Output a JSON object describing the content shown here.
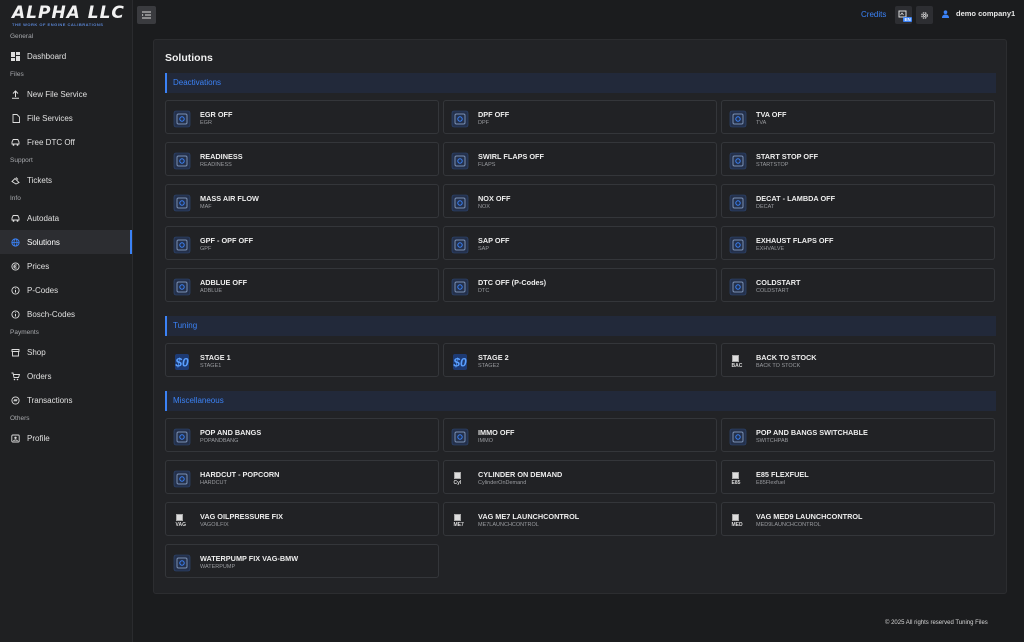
{
  "brand": {
    "name": "ALPHA LLC",
    "tagline": "THE WORK OF ENGINE CALIBRATIONS"
  },
  "sidebar": {
    "sections": [
      {
        "label": "General",
        "items": [
          {
            "label": "Dashboard",
            "icon": "dashboard-icon"
          }
        ]
      },
      {
        "label": "Files",
        "items": [
          {
            "label": "New File Service",
            "icon": "upload-icon"
          },
          {
            "label": "File Services",
            "icon": "file-icon"
          },
          {
            "label": "Free DTC Off",
            "icon": "car-icon"
          }
        ]
      },
      {
        "label": "Support",
        "items": [
          {
            "label": "Tickets",
            "icon": "ticket-icon"
          }
        ]
      },
      {
        "label": "Info",
        "items": [
          {
            "label": "Autodata",
            "icon": "car-icon"
          },
          {
            "label": "Solutions",
            "icon": "globe-icon",
            "active": true
          },
          {
            "label": "Prices",
            "icon": "euro-icon"
          },
          {
            "label": "P-Codes",
            "icon": "info-icon"
          },
          {
            "label": "Bosch-Codes",
            "icon": "info-icon"
          }
        ]
      },
      {
        "label": "Payments",
        "items": [
          {
            "label": "Shop",
            "icon": "shop-icon"
          },
          {
            "label": "Orders",
            "icon": "cart-icon"
          },
          {
            "label": "Transactions",
            "icon": "transactions-icon"
          }
        ]
      },
      {
        "label": "Others",
        "items": [
          {
            "label": "Profile",
            "icon": "profile-icon"
          }
        ]
      }
    ]
  },
  "header": {
    "credits_label": "Credits",
    "lang_badge": "EN",
    "user_name": "demo company1"
  },
  "page": {
    "title": "Solutions"
  },
  "groups": [
    {
      "label": "Deactivations",
      "items": [
        {
          "title": "EGR OFF",
          "sub": "EGR",
          "icon": "egr-icon"
        },
        {
          "title": "DPF OFF",
          "sub": "DPF",
          "icon": "dpf-icon"
        },
        {
          "title": "TVA OFF",
          "sub": "TVA",
          "icon": "tva-icon"
        },
        {
          "title": "READINESS",
          "sub": "READINESS",
          "icon": "readiness-icon"
        },
        {
          "title": "SWIRL FLAPS OFF",
          "sub": "FLAPS",
          "icon": "swirl-flaps-icon"
        },
        {
          "title": "START STOP OFF",
          "sub": "STARTSTOP",
          "icon": "start-stop-icon"
        },
        {
          "title": "MASS AIR FLOW",
          "sub": "MAF",
          "icon": "maf-icon"
        },
        {
          "title": "NOX OFF",
          "sub": "NOX",
          "icon": "nox-icon"
        },
        {
          "title": "DECAT - LAMBDA OFF",
          "sub": "DECAT",
          "icon": "decat-icon"
        },
        {
          "title": "GPF - OPF OFF",
          "sub": "GPF",
          "icon": "gpf-icon"
        },
        {
          "title": "SAP OFF",
          "sub": "SAP",
          "icon": "sap-icon"
        },
        {
          "title": "EXHAUST FLAPS OFF",
          "sub": "EXHVALVE",
          "icon": "exhaust-flaps-icon"
        },
        {
          "title": "ADBLUE OFF",
          "sub": "ADBLUE",
          "icon": "adblue-icon"
        },
        {
          "title": "DTC OFF (P-Codes)",
          "sub": "DTC",
          "icon": "dtc-icon"
        },
        {
          "title": "COLDSTART",
          "sub": "COLDSTART",
          "icon": "coldstart-icon"
        }
      ]
    },
    {
      "label": "Tuning",
      "items": [
        {
          "title": "STAGE 1",
          "sub": "STAGE1",
          "icon": "stage-icon"
        },
        {
          "title": "STAGE 2",
          "sub": "STAGE2",
          "icon": "stage-icon"
        },
        {
          "title": "BACK TO STOCK",
          "sub": "BACK TO STOCK",
          "icon": "broken-image-icon",
          "alt": "BAC"
        }
      ]
    },
    {
      "label": "Miscellaneous",
      "items": [
        {
          "title": "POP AND BANGS",
          "sub": "POPANDBANG",
          "icon": "pop-bang-icon"
        },
        {
          "title": "IMMO OFF",
          "sub": "IMMO",
          "icon": "immo-icon"
        },
        {
          "title": "POP AND BANGS SWITCHABLE",
          "sub": "SWITCHPAB",
          "icon": "pop-bang-icon"
        },
        {
          "title": "HARDCUT - POPCORN",
          "sub": "HARDCUT",
          "icon": "hardcut-icon"
        },
        {
          "title": "CYLINDER ON DEMAND",
          "sub": "CylinderOnDemand",
          "icon": "broken-image-icon",
          "alt": "Cyl"
        },
        {
          "title": "E85 FLEXFUEL",
          "sub": "E85Flexfuel",
          "icon": "broken-image-icon",
          "alt": "E85"
        },
        {
          "title": "VAG OILPRESSURE FIX",
          "sub": "VAGOILFIX",
          "icon": "broken-image-icon",
          "alt": "VAG"
        },
        {
          "title": "VAG ME7 LAUNCHCONTROL",
          "sub": "ME7LAUNCHCONTROL",
          "icon": "broken-image-icon",
          "alt": "ME7"
        },
        {
          "title": "VAG MED9 LAUNCHCONTROL",
          "sub": "MED9LAUNCHCONTROL",
          "icon": "broken-image-icon",
          "alt": "MED"
        },
        {
          "title": "WATERPUMP FIX VAG-BMW",
          "sub": "WATERPUMP",
          "icon": "waterpump-icon"
        }
      ]
    }
  ],
  "footer": {
    "text": "© 2025 All rights reserved Tuning Files"
  },
  "colors": {
    "accent": "#3b82f6",
    "panel": "#222326",
    "sidebar": "#1f2022"
  }
}
